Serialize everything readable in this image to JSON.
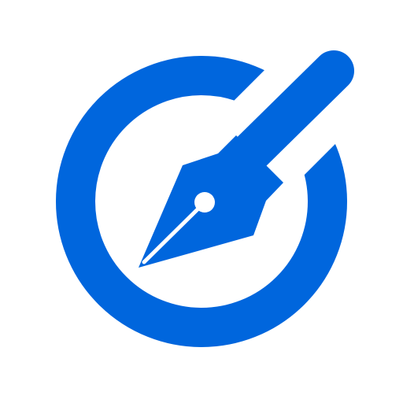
{
  "icon": {
    "name": "fountain-pen-in-ring-icon",
    "accent_color": "#0066dd",
    "background_color": "#ffffff"
  }
}
